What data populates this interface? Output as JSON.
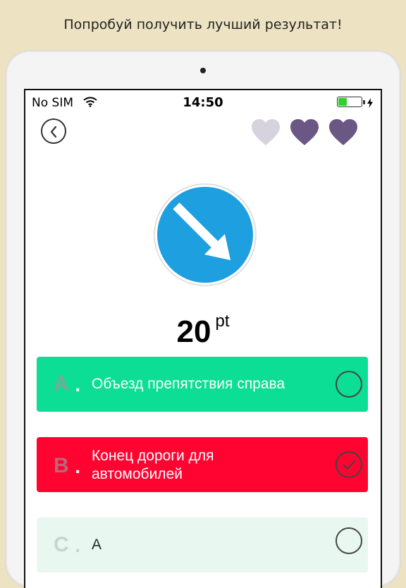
{
  "promo_text": "Попробуй получить лучший результат!",
  "status_bar": {
    "carrier": "No SIM",
    "time": "14:50",
    "battery_color": "#2fd22c"
  },
  "header": {
    "back_icon": "chevron-left-icon",
    "lives": [
      {
        "icon": "heart-icon",
        "state": "lost",
        "color": "#d6d3de"
      },
      {
        "icon": "heart-icon",
        "state": "full",
        "color": "#6a5783"
      },
      {
        "icon": "heart-icon",
        "state": "full",
        "color": "#6a5783"
      }
    ]
  },
  "question": {
    "sign_icon": "road-sign-pass-right-icon",
    "sign_color": "#1e9fe0"
  },
  "score": {
    "value": "20",
    "unit": "pt"
  },
  "answers": [
    {
      "letter": "A",
      "dot": ".",
      "text": "Объезд препятствия справа",
      "bg": "#0cde95",
      "state": "unselected"
    },
    {
      "letter": "B",
      "dot": ".",
      "text": "Конец дороги для автомобилей",
      "bg": "#ff0431",
      "state": "checked"
    },
    {
      "letter": "C",
      "dot": ".",
      "text": "А",
      "bg": "#e8f8f0",
      "state": "unselected"
    }
  ]
}
